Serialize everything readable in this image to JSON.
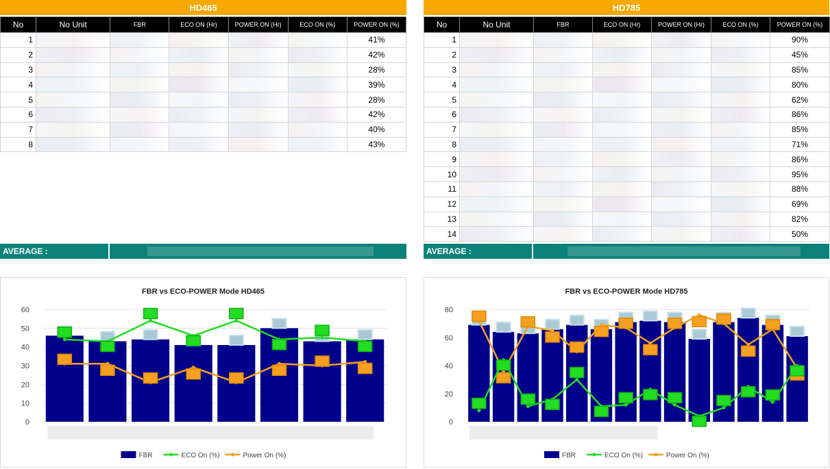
{
  "left": {
    "title": "HD465",
    "headers": [
      "No",
      "No Unit",
      "FBR",
      "ECO ON (Hr)",
      "POWER ON (Hr)",
      "ECO ON (%)",
      "POWER ON (%)"
    ],
    "rows": [
      {
        "no": "1",
        "power_pct": "41%"
      },
      {
        "no": "2",
        "power_pct": "42%"
      },
      {
        "no": "3",
        "power_pct": "28%"
      },
      {
        "no": "4",
        "power_pct": "39%"
      },
      {
        "no": "5",
        "power_pct": "28%"
      },
      {
        "no": "6",
        "power_pct": "42%"
      },
      {
        "no": "7",
        "power_pct": "40%"
      },
      {
        "no": "8",
        "power_pct": "43%"
      }
    ],
    "average_label": "AVERAGE :"
  },
  "right": {
    "title": "HD785",
    "headers": [
      "No",
      "No Unit",
      "FBR",
      "ECO ON (Hr)",
      "POWER ON (Hr)",
      "ECO ON (%)",
      "POWER ON (%)"
    ],
    "rows": [
      {
        "no": "1",
        "power_pct": "90%"
      },
      {
        "no": "2",
        "power_pct": "45%"
      },
      {
        "no": "3",
        "power_pct": "85%"
      },
      {
        "no": "4",
        "power_pct": "80%"
      },
      {
        "no": "5",
        "power_pct": "62%"
      },
      {
        "no": "6",
        "power_pct": "86%"
      },
      {
        "no": "7",
        "power_pct": "85%"
      },
      {
        "no": "8",
        "power_pct": "71%"
      },
      {
        "no": "9",
        "power_pct": "86%"
      },
      {
        "no": "10",
        "power_pct": "95%"
      },
      {
        "no": "11",
        "power_pct": "88%"
      },
      {
        "no": "12",
        "power_pct": "69%"
      },
      {
        "no": "13",
        "power_pct": "82%"
      },
      {
        "no": "14",
        "power_pct": "50%"
      }
    ],
    "average_label": "AVERAGE :"
  },
  "colors": {
    "banner": "#f8a800",
    "average_bar": "#0b8279",
    "fbr_bar": "#00008b",
    "eco_line": "#22dd22",
    "power_line": "#f5a020",
    "header_bg": "#000000"
  },
  "chart_data": [
    {
      "type": "bar",
      "title": "FBR vs ECO-POWER Mode HD465",
      "ylim": [
        0,
        60
      ],
      "yticks": [
        0,
        10,
        20,
        30,
        40,
        50,
        60
      ],
      "grid": true,
      "legend_position": "bottom",
      "legend": [
        "FBR",
        "ECO On (%)",
        "Power On (%)"
      ],
      "categories_count": 8,
      "series": [
        {
          "name": "FBR",
          "kind": "bar",
          "values": [
            46,
            43,
            44,
            41,
            41,
            50,
            43,
            44
          ]
        },
        {
          "name": "ECO On (%)",
          "kind": "line",
          "values": [
            44,
            43,
            54,
            46,
            54,
            44,
            45,
            43
          ]
        },
        {
          "name": "Power On (%)",
          "kind": "line",
          "values": [
            31,
            31,
            21,
            29,
            21,
            31,
            30,
            32
          ]
        }
      ]
    },
    {
      "type": "bar",
      "title": "FBR vs ECO-POWER Mode HD785",
      "ylim": [
        0,
        80
      ],
      "yticks": [
        0,
        20,
        40,
        60,
        80
      ],
      "grid": true,
      "legend_position": "bottom",
      "legend": [
        "FBR",
        "ECO On (%)",
        "Power On (%)"
      ],
      "categories_count": 14,
      "series": [
        {
          "name": "FBR",
          "kind": "bar",
          "values": [
            69,
            64,
            63,
            66,
            69,
            66,
            71,
            72,
            71,
            59,
            71,
            74,
            69,
            61
          ]
        },
        {
          "name": "ECO On (%)",
          "kind": "line",
          "values": [
            8,
            44,
            11,
            16,
            30,
            11,
            12,
            23,
            12,
            4,
            10,
            25,
            14,
            40
          ]
        },
        {
          "name": "Power On (%)",
          "kind": "line",
          "values": [
            72,
            36,
            68,
            65,
            50,
            69,
            67,
            56,
            67,
            76,
            70,
            55,
            66,
            38
          ]
        }
      ]
    }
  ]
}
